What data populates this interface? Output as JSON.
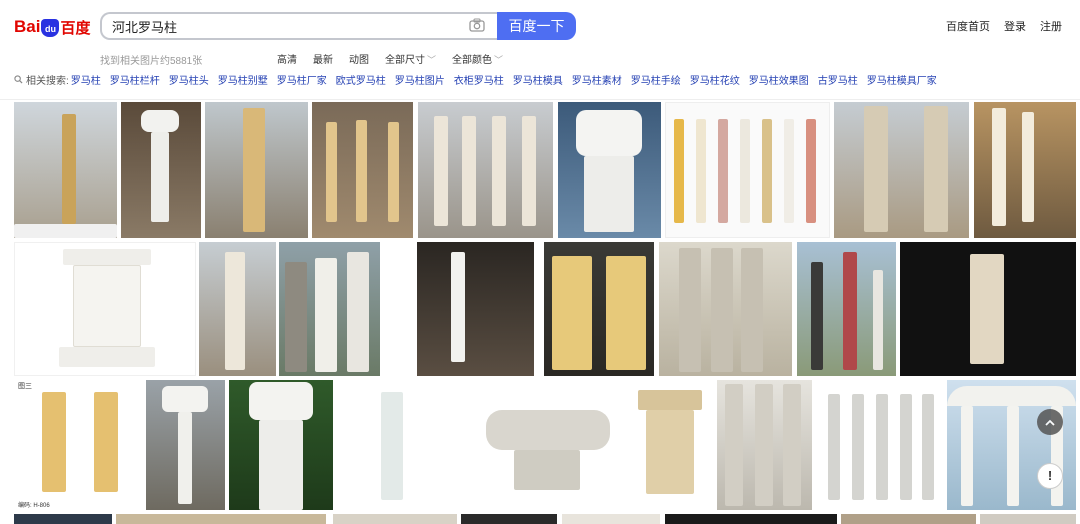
{
  "logo": {
    "text_bai": "Bai",
    "text_du": "du",
    "text_cn": "百度"
  },
  "search": {
    "query": "河北罗马柱",
    "button_label": "百度一下"
  },
  "top_links": [
    "百度首页",
    "登录",
    "注册"
  ],
  "result_count": "找到相关图片约5881张",
  "filters": [
    {
      "label": "高清",
      "dropdown": false
    },
    {
      "label": "最新",
      "dropdown": false
    },
    {
      "label": "动图",
      "dropdown": false
    },
    {
      "label": "全部尺寸",
      "dropdown": true
    },
    {
      "label": "全部颜色",
      "dropdown": true
    }
  ],
  "related": {
    "label": "相关搜索:",
    "items": [
      "罗马柱",
      "罗马柱栏杆",
      "罗马柱头",
      "罗马柱别墅",
      "罗马柱厂家",
      "欧式罗马柱",
      "罗马柱图片",
      "衣柜罗马柱",
      "罗马柱模具",
      "罗马柱素材",
      "罗马柱手绘",
      "罗马柱花纹",
      "罗马柱效果图",
      "古罗马柱",
      "罗马柱模具厂家"
    ]
  },
  "image_labels": {
    "tile_label_1": "图三",
    "tile_label_2": "编码: H-806"
  },
  "floating": {
    "scroll_icon": "chevron-up-icon",
    "help_label": "!"
  },
  "colors": {
    "accent": "#4e6ef2",
    "logo_red": "#e10601",
    "logo_blue": "#2932e1",
    "link": "#2440b3"
  }
}
